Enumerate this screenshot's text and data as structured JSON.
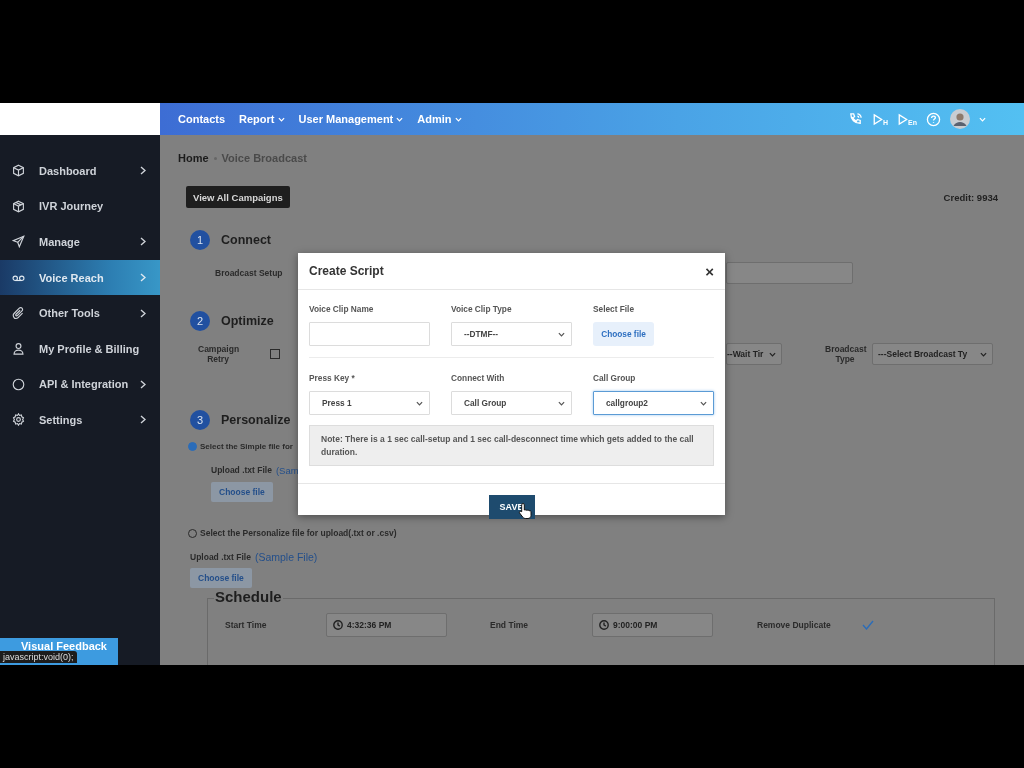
{
  "top_nav": {
    "items": [
      {
        "label": "Contacts",
        "dropdown": false
      },
      {
        "label": "Report",
        "dropdown": true
      },
      {
        "label": "User Management",
        "dropdown": true
      },
      {
        "label": "Admin",
        "dropdown": true
      }
    ],
    "player_badges": [
      "H",
      "En"
    ]
  },
  "sidebar": {
    "items": [
      {
        "label": "Dashboard",
        "selected": false,
        "has_submenu": true
      },
      {
        "label": "IVR Journey",
        "selected": false,
        "has_submenu": false
      },
      {
        "label": "Manage",
        "selected": false,
        "has_submenu": true
      },
      {
        "label": "Voice Reach",
        "selected": true,
        "has_submenu": true
      },
      {
        "label": "Other Tools",
        "selected": false,
        "has_submenu": true
      },
      {
        "label": "My Profile & Billing",
        "selected": false,
        "has_submenu": false
      },
      {
        "label": "API & Integration",
        "selected": false,
        "has_submenu": true
      },
      {
        "label": "Settings",
        "selected": false,
        "has_submenu": true
      }
    ]
  },
  "breadcrumb": [
    "Home",
    "Voice Broadcast"
  ],
  "view_all_button": "View All Campaigns",
  "credit": "Credit: 9934",
  "steps": [
    {
      "number": "1",
      "title": "Connect"
    },
    {
      "number": "2",
      "title": "Optimize"
    },
    {
      "number": "3",
      "title": "Personalize"
    }
  ],
  "connect": {
    "label": "Broadcast Setup"
  },
  "optimize": {
    "retry_label": "Campaign Retry",
    "retry_checked": false,
    "wait_select": "--Wait Tir",
    "type_label": "Broadcast Type",
    "type_select": "---Select Broadcast Ty"
  },
  "personalize": {
    "options": [
      {
        "label": "Select the Simple file for",
        "selected": true,
        "upload_label": "Upload .txt File",
        "sample_link": "(Sam",
        "button": "Choose file"
      },
      {
        "label": "Select the Personalize file for upload(.txt or .csv)",
        "selected": false,
        "upload_label": "Upload .txt File",
        "sample_link": "(Sample File)",
        "button": "Choose file"
      }
    ]
  },
  "schedule": {
    "title": "Schedule",
    "start_label": "Start Time",
    "start_value": "4:32:36 PM",
    "end_label": "End Time",
    "end_value": "9:00:00 PM",
    "duplicate_label": "Remove Duplicate",
    "remove_duplicate": true
  },
  "modal": {
    "title": "Create Script",
    "close": "×",
    "fields": [
      {
        "kind": "text",
        "label": "Voice Clip Name"
      },
      {
        "kind": "select",
        "label": "Voice Clip Type",
        "value": "--DTMF--",
        "focused": false
      },
      {
        "kind": "file",
        "label": "Select File",
        "value": "Choose file"
      },
      {
        "kind": "select",
        "label": "Press Key *",
        "value": "Press 1",
        "focused": false
      },
      {
        "kind": "select",
        "label": "Connect With",
        "value": "Call Group",
        "focused": false
      },
      {
        "kind": "select",
        "label": "Call Group",
        "value": "callgroup2",
        "focused": true
      }
    ],
    "note": "Note: There is a 1 sec call-setup and 1 sec call-desconnect time which gets added to the call duration.",
    "save_button": "SAVE"
  },
  "feedback_button": "Visual Feedback",
  "status_url": "javascript:void(0);"
}
